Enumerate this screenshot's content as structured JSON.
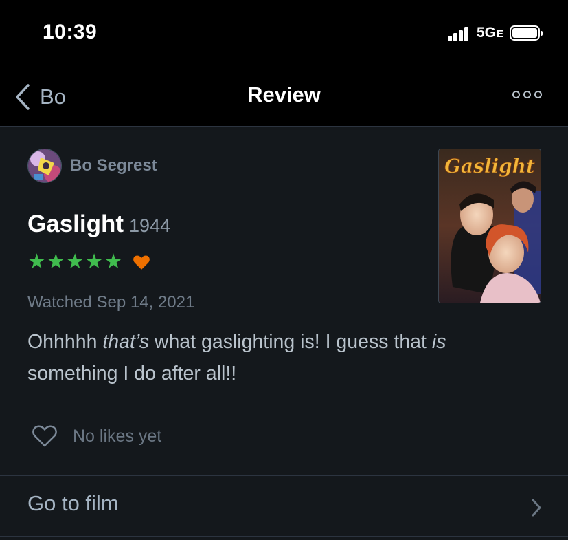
{
  "status_bar": {
    "time": "10:39",
    "network": "5G",
    "network_suffix": "E"
  },
  "nav": {
    "back_label": "Bo",
    "title": "Review"
  },
  "review": {
    "author": "Bo Segrest",
    "film_title": "Gaslight",
    "film_year": "1944",
    "rating_stars": 5,
    "liked": true,
    "stars_display": "★★★★★",
    "watched": "Watched Sep 14, 2021",
    "text_parts": [
      "Ohhhhh ",
      "that’s",
      " what gaslighting is! I guess that ",
      "is",
      " something I do after all!!"
    ],
    "poster_title": "Gaslight",
    "likes_label": "No likes yet"
  },
  "footer": {
    "go_to_film": "Go to film"
  },
  "colors": {
    "background": "#14181c",
    "star_green": "#40bc4e",
    "heart_orange": "#ee7000",
    "muted_text": "#6f7b88"
  }
}
